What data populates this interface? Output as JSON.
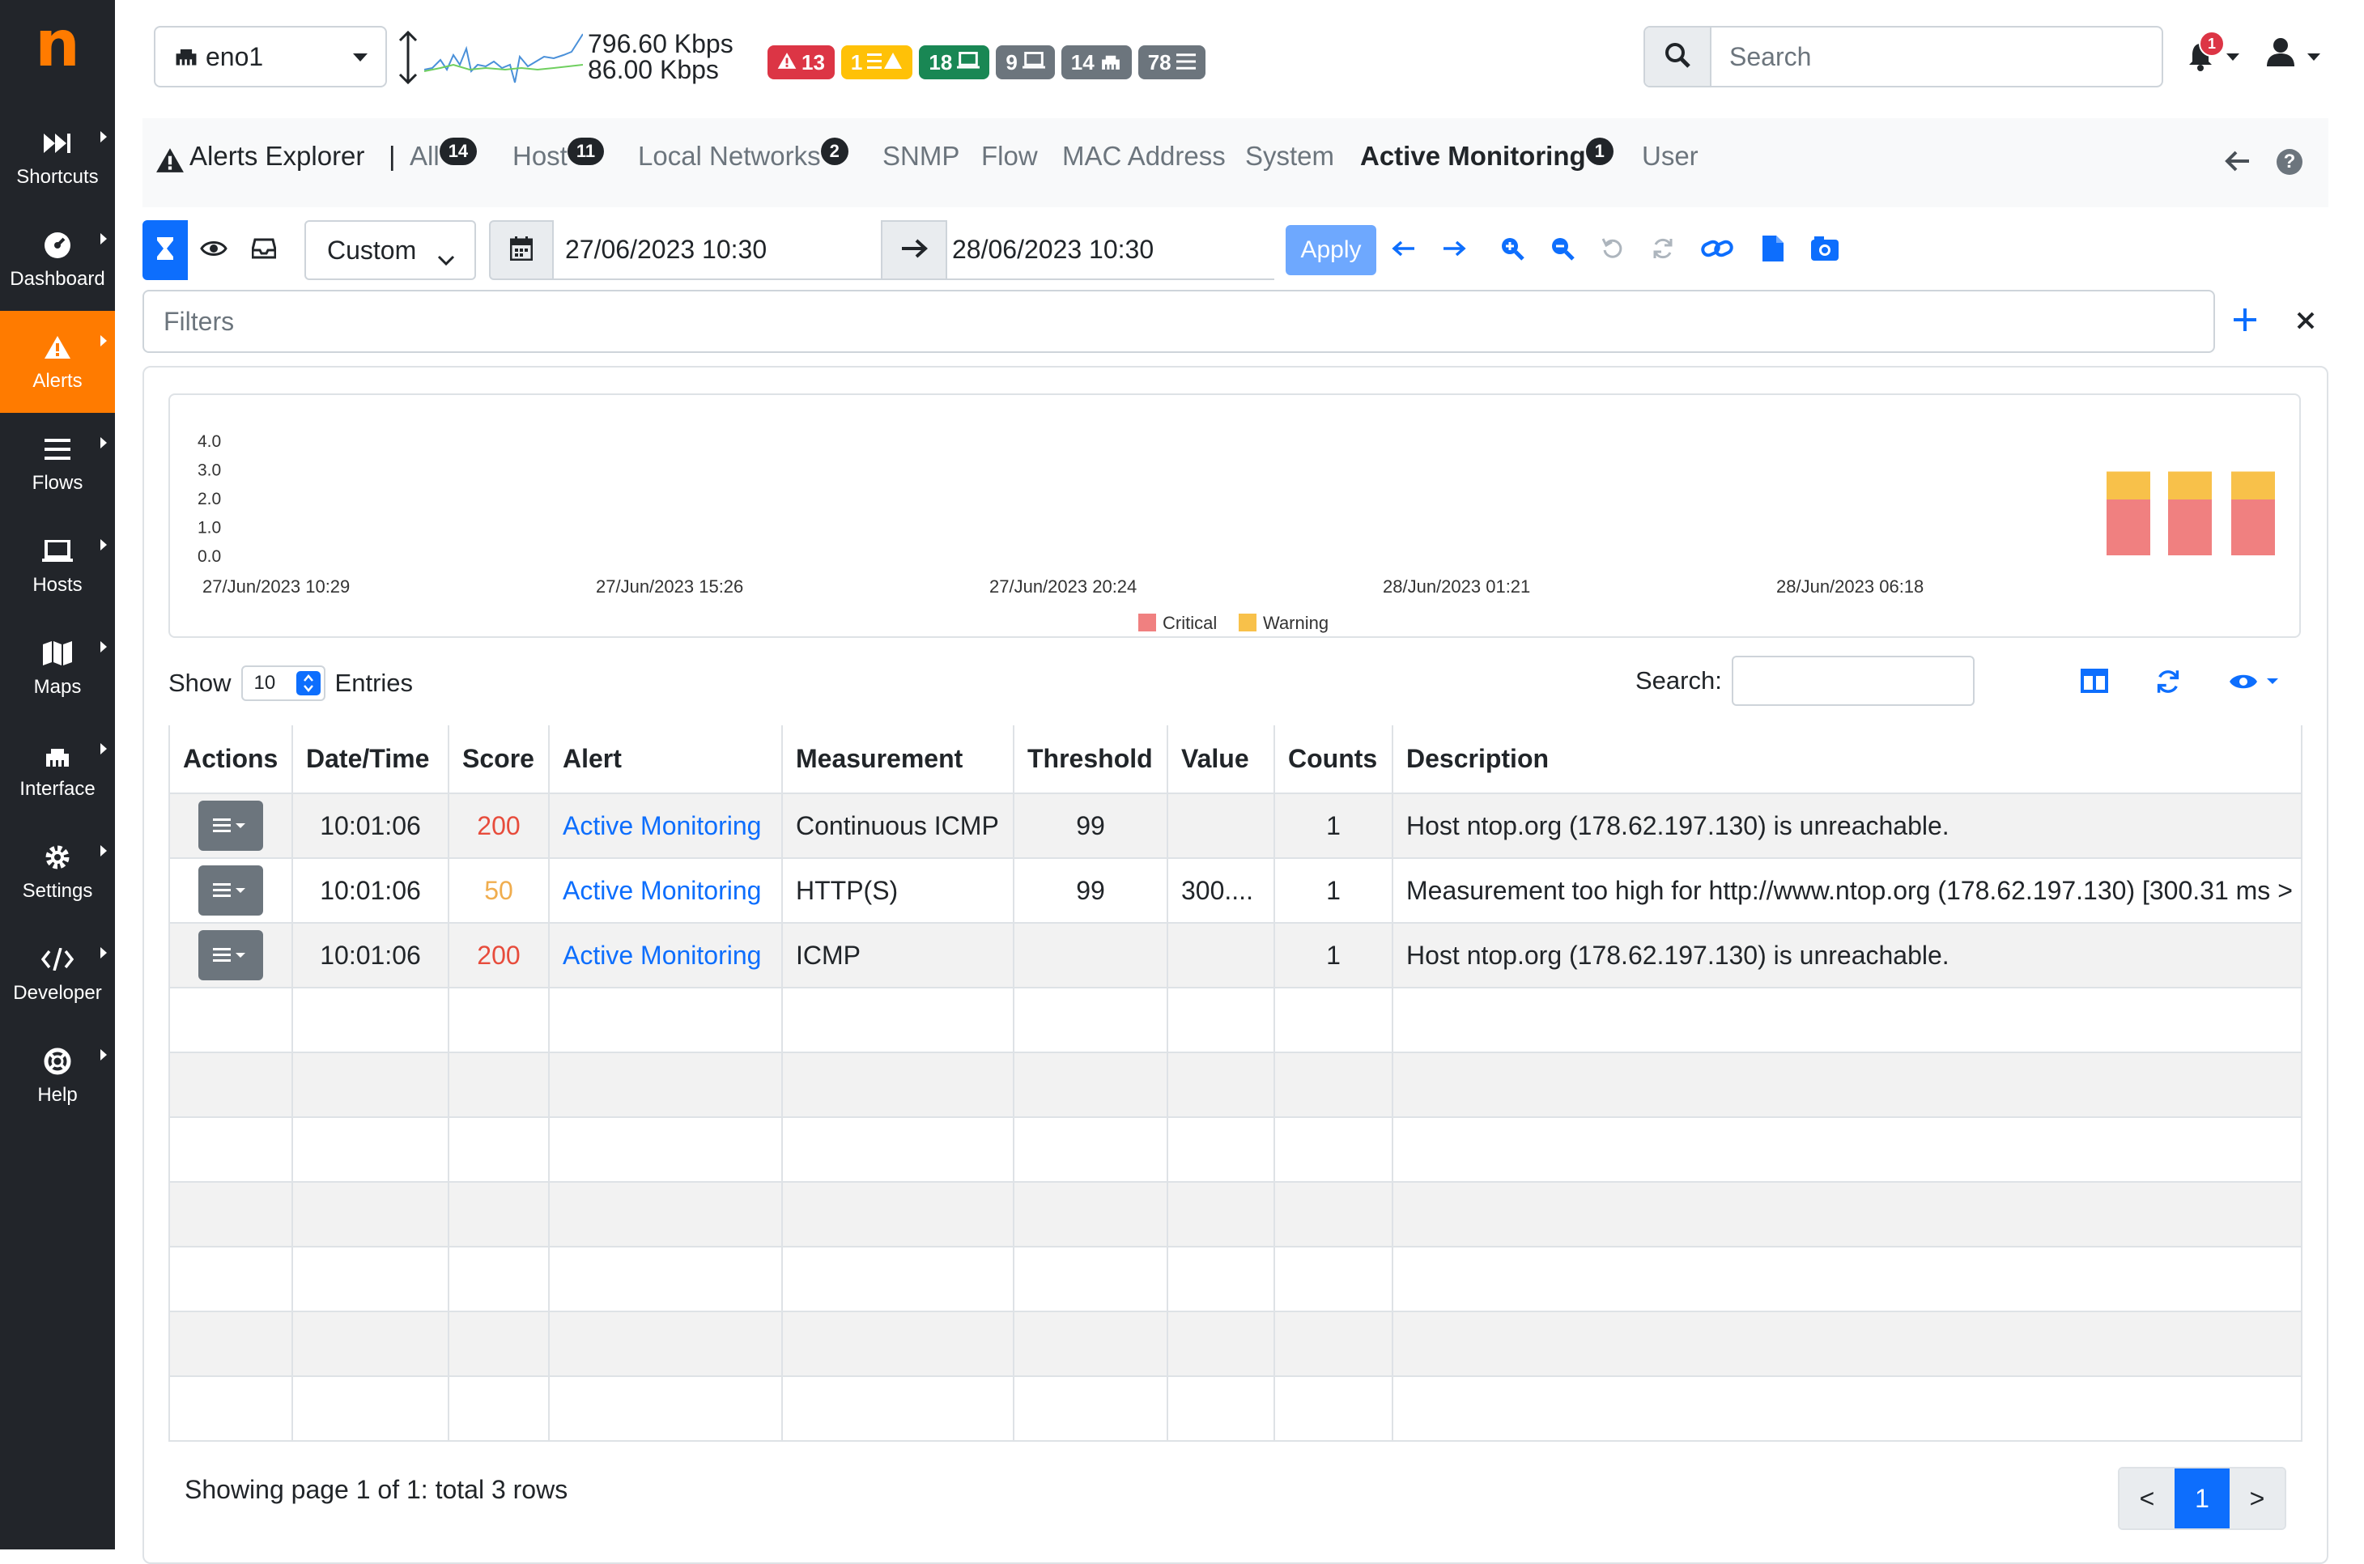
{
  "sidebar": {
    "logo": "n",
    "items": [
      {
        "label": "Shortcuts",
        "icon": "fast-forward-icon"
      },
      {
        "label": "Dashboard",
        "icon": "gauge-icon"
      },
      {
        "label": "Alerts",
        "icon": "warning-icon"
      },
      {
        "label": "Flows",
        "icon": "list-icon"
      },
      {
        "label": "Hosts",
        "icon": "laptop-icon"
      },
      {
        "label": "Maps",
        "icon": "map-icon"
      },
      {
        "label": "Interface",
        "icon": "ethernet-icon"
      },
      {
        "label": "Settings",
        "icon": "gear-icon"
      },
      {
        "label": "Developer",
        "icon": "code-icon"
      },
      {
        "label": "Help",
        "icon": "lifebuoy-icon"
      }
    ]
  },
  "header": {
    "interface": "eno1",
    "traffic_up": "796.60 Kbps",
    "traffic_down": "86.00 Kbps",
    "badges": [
      {
        "value": "13",
        "color": "#dc3545",
        "icon": "warning-icon"
      },
      {
        "value": "1",
        "color": "#ffc107",
        "icon": "list-warning-icon"
      },
      {
        "value": "18",
        "color": "#198754",
        "icon": "laptop-icon"
      },
      {
        "value": "9",
        "color": "#6c757d",
        "icon": "laptop-icon"
      },
      {
        "value": "14",
        "color": "#6c757d",
        "icon": "ethernet-icon"
      },
      {
        "value": "78",
        "color": "#6c757d",
        "icon": "list-icon"
      }
    ],
    "search_placeholder": "Search",
    "notification_count": "1"
  },
  "tabs": {
    "title": "Alerts Explorer",
    "separator": "|",
    "items": [
      {
        "label": "All",
        "count": "14"
      },
      {
        "label": "Host",
        "count": "11"
      },
      {
        "label": "Local Networks",
        "count": "2"
      },
      {
        "label": "SNMP",
        "count": ""
      },
      {
        "label": "Flow",
        "count": ""
      },
      {
        "label": "MAC Address",
        "count": ""
      },
      {
        "label": "System",
        "count": ""
      },
      {
        "label": "Active Monitoring",
        "count": "1"
      },
      {
        "label": "User",
        "count": ""
      }
    ]
  },
  "toolbar": {
    "range_select": "Custom",
    "date_from": "27/06/2023 10:30",
    "date_to": "28/06/2023 10:30",
    "apply_label": "Apply"
  },
  "filters": {
    "placeholder": "Filters"
  },
  "chart_data": {
    "type": "bar",
    "stacked": true,
    "yticks": [
      "4.0",
      "3.0",
      "2.0",
      "1.0",
      "0.0"
    ],
    "ylim": [
      0,
      4
    ],
    "xticks": [
      "27/Jun/2023 10:29",
      "27/Jun/2023 15:26",
      "27/Jun/2023 20:24",
      "28/Jun/2023 01:21",
      "28/Jun/2023 06:18"
    ],
    "series": [
      {
        "name": "Critical",
        "color": "#f08080",
        "values": [
          2,
          2,
          2
        ]
      },
      {
        "name": "Warning",
        "color": "#f8c14a",
        "values": [
          1,
          1,
          1
        ]
      }
    ],
    "legend": "bottom"
  },
  "table": {
    "show_label": "Show",
    "entries_value": "10",
    "entries_label": "Entries",
    "search_label": "Search:",
    "columns": [
      "Actions",
      "Date/Time",
      "Score",
      "Alert",
      "Measurement",
      "Threshold",
      "Value",
      "Counts",
      "Description"
    ],
    "rows": [
      {
        "time": "10:01:06",
        "score": "200",
        "score_color": "#e74c3c",
        "alert": "Active Monitoring",
        "measurement": "Continuous ICMP",
        "threshold": "99",
        "value": "",
        "counts": "1",
        "description": "Host ntop.org (178.62.197.130) is unreachable."
      },
      {
        "time": "10:01:06",
        "score": "50",
        "score_color": "#f0ad4e",
        "alert": "Active Monitoring",
        "measurement": "HTTP(S)",
        "threshold": "99",
        "value": "300....",
        "counts": "1",
        "description": "Measurement too high for http://www.ntop.org (178.62.197.130) [300.31 ms >"
      },
      {
        "time": "10:01:06",
        "score": "200",
        "score_color": "#e74c3c",
        "alert": "Active Monitoring",
        "measurement": "ICMP",
        "threshold": "",
        "value": "",
        "counts": "1",
        "description": "Host ntop.org (178.62.197.130) is unreachable."
      }
    ],
    "footer": "Showing page 1 of 1: total 3 rows",
    "pager": {
      "prev": "<",
      "current": "1",
      "next": ">"
    }
  }
}
